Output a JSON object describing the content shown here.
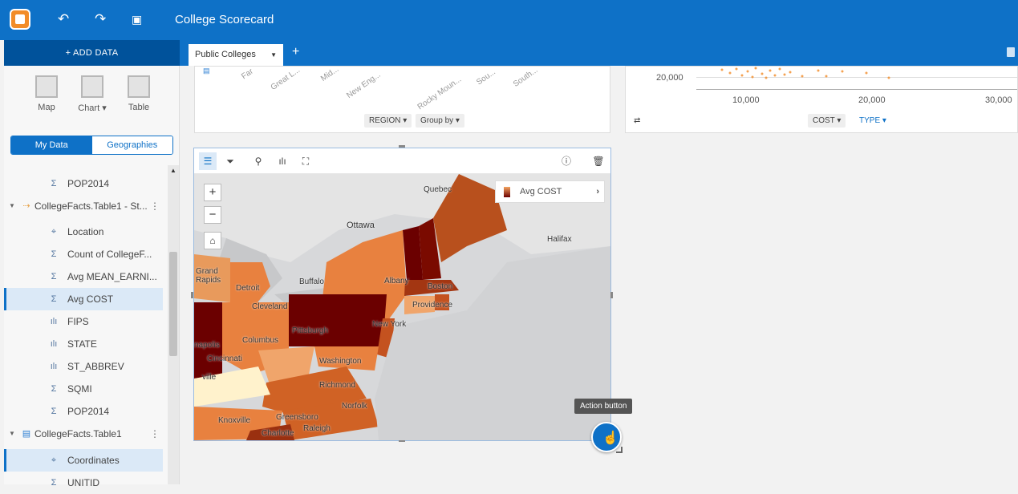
{
  "app": {
    "title": "College Scorecard"
  },
  "toolbar": {
    "undo_icon": "undo-icon",
    "redo_icon": "redo-icon",
    "save_icon": "save-icon"
  },
  "sidebar": {
    "add_data_label": "+ ADD DATA",
    "viz_buttons": [
      {
        "label": "Map"
      },
      {
        "label": "Chart ▾"
      },
      {
        "label": "Table"
      }
    ],
    "tabs": {
      "my_data": "My Data",
      "geographies": "Geographies"
    },
    "fields_top": [
      {
        "label": "POP2014",
        "type": "Σ"
      }
    ],
    "dataset1": {
      "label": "CollegeFacts.Table1 - St...",
      "fields": [
        {
          "label": "Location",
          "type": "⌖"
        },
        {
          "label": "Count of CollegeF...",
          "type": "Σ"
        },
        {
          "label": "Avg MEAN_EARNI...",
          "type": "Σ"
        },
        {
          "label": "Avg COST",
          "type": "Σ"
        },
        {
          "label": "FIPS",
          "type": "ılı"
        },
        {
          "label": "STATE",
          "type": "ılı"
        },
        {
          "label": "ST_ABBREV",
          "type": "ılı"
        },
        {
          "label": "SQMI",
          "type": "Σ"
        },
        {
          "label": "POP2014",
          "type": "Σ"
        }
      ]
    },
    "dataset2": {
      "label": "CollegeFacts.Table1",
      "fields": [
        {
          "label": "Coordinates",
          "type": "⌖"
        },
        {
          "label": "UNITID",
          "type": "Σ"
        }
      ]
    }
  },
  "page_tabs": {
    "active": "Public Colleges",
    "add": "+"
  },
  "bar_card": {
    "categories": [
      "Far",
      "Great L...",
      "Mid...",
      "New Eng...",
      "",
      "Rocky Moun...",
      "Sou...",
      "South..."
    ],
    "region_pill": "REGION ▾",
    "groupby_pill": "Group by ▾"
  },
  "scatter_card": {
    "y_tick": "20,000",
    "x_ticks": [
      "10,000",
      "20,000",
      "30,000"
    ],
    "cost_pill": "COST ▾",
    "type_pill": "TYPE ▾"
  },
  "map_card": {
    "legend_label": "Avg COST",
    "zoom_in": "+",
    "zoom_out": "−",
    "cities": [
      "Quebec",
      "Ottawa",
      "Halifax",
      "Grand Rapids",
      "Detroit",
      "Buffalo",
      "Albany",
      "Boston",
      "Providence",
      "Cleveland",
      "Pittsburgh",
      "New York",
      "Columbus",
      "Cincinnati",
      "Washington",
      "Richmond",
      "Norfolk",
      "Greensboro",
      "Raleigh",
      "Charlotte",
      "Knoxville",
      "napolis",
      "ville"
    ]
  },
  "tooltip": {
    "text": "Action button"
  },
  "colors": {
    "brand": "#0e71c7",
    "dark_brand": "#00529b",
    "map_dark": "#6b0000"
  }
}
